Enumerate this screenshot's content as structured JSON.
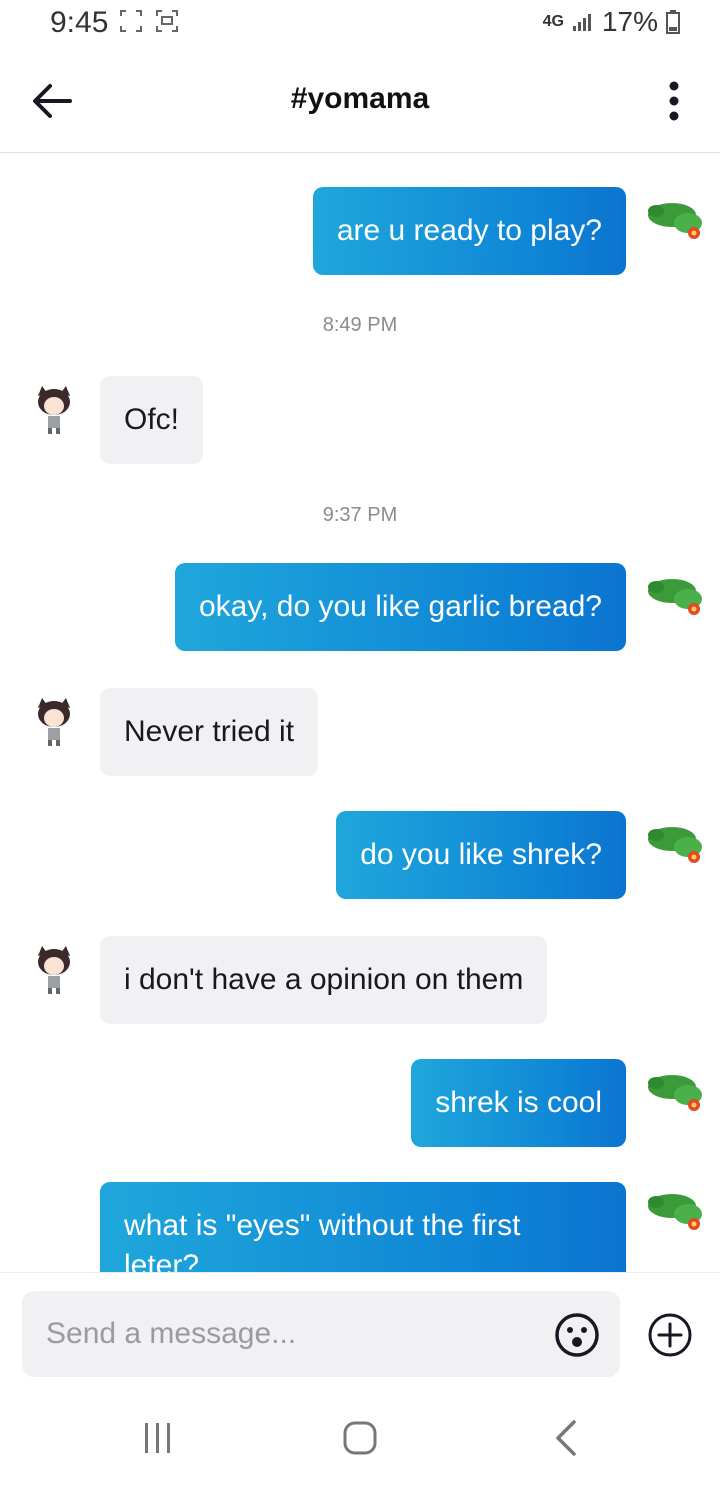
{
  "status_bar": {
    "time": "9:45",
    "network": "4G",
    "battery": "17%"
  },
  "header": {
    "title": "#yomama"
  },
  "messages": [
    {
      "type": "out",
      "text": "are u ready to play?"
    },
    {
      "type": "time",
      "text": "8:49 PM"
    },
    {
      "type": "in",
      "text": "Ofc!"
    },
    {
      "type": "time",
      "text": "9:37 PM"
    },
    {
      "type": "out",
      "text": "okay, do you like garlic bread?"
    },
    {
      "type": "in",
      "text": "Never tried it"
    },
    {
      "type": "out",
      "text": "do you like shrek?"
    },
    {
      "type": "in",
      "text": "i don't have a opinion on them"
    },
    {
      "type": "out",
      "text": "shrek is cool"
    },
    {
      "type": "out",
      "text": "what is \"eyes\" without the first leter?"
    }
  ],
  "input": {
    "placeholder": "Send a message..."
  },
  "icons": {
    "back": "back-arrow-icon",
    "more": "more-vertical-icon",
    "emoji": "emoji-icon",
    "add": "plus-circle-icon",
    "nav_recents": "recents-icon",
    "nav_home": "home-icon",
    "nav_back": "nav-back-icon"
  },
  "colors": {
    "outgoing_bubble": "#0f86d6",
    "incoming_bubble": "#f1f1f3",
    "timestamp": "#8a8b91"
  }
}
